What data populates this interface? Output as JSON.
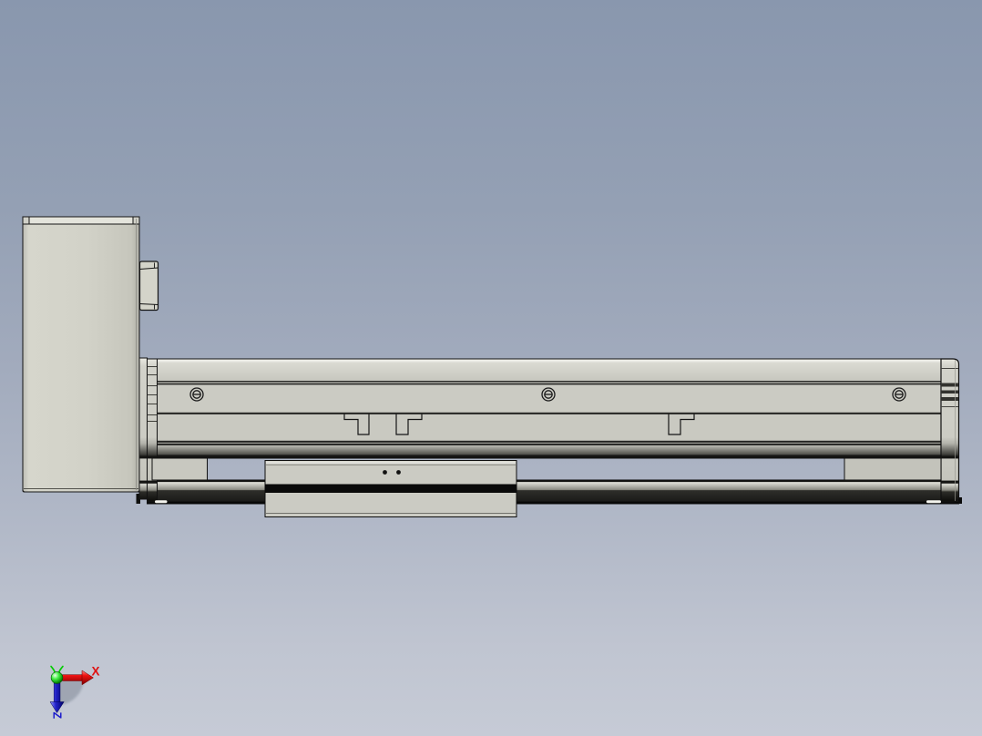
{
  "viewport": {
    "application": "cad-3d-viewport",
    "view_name": "side view",
    "model_label": "linear actuator slide module"
  },
  "triad": {
    "x_label": "X",
    "z_label": "Z",
    "x_color": "#e01010",
    "z_color": "#1a1acc",
    "y_color": "#00cc00",
    "origin_color": "#22cc22"
  },
  "colors": {
    "background_top": "#8997ae",
    "background_bottom": "#c6cbd6",
    "part_light": "#ccccc4",
    "part_highlight": "#f0f0ea",
    "part_dark_band": "#1a1a18",
    "outline": "#141414"
  },
  "counts": {
    "screw_heads": 3,
    "t_slot_profiles": 3,
    "support_blocks": 2
  },
  "parts": {
    "motor_housing": "motor-housing",
    "connector_bracket": "connector-bracket",
    "rail_body": "rail-extrusion-body",
    "carriage": "carriage-slider",
    "left_end_cap": "left-end-cap",
    "right_end_cap": "right-end-cap",
    "left_support": "left-support-block",
    "right_support": "right-support-block"
  }
}
